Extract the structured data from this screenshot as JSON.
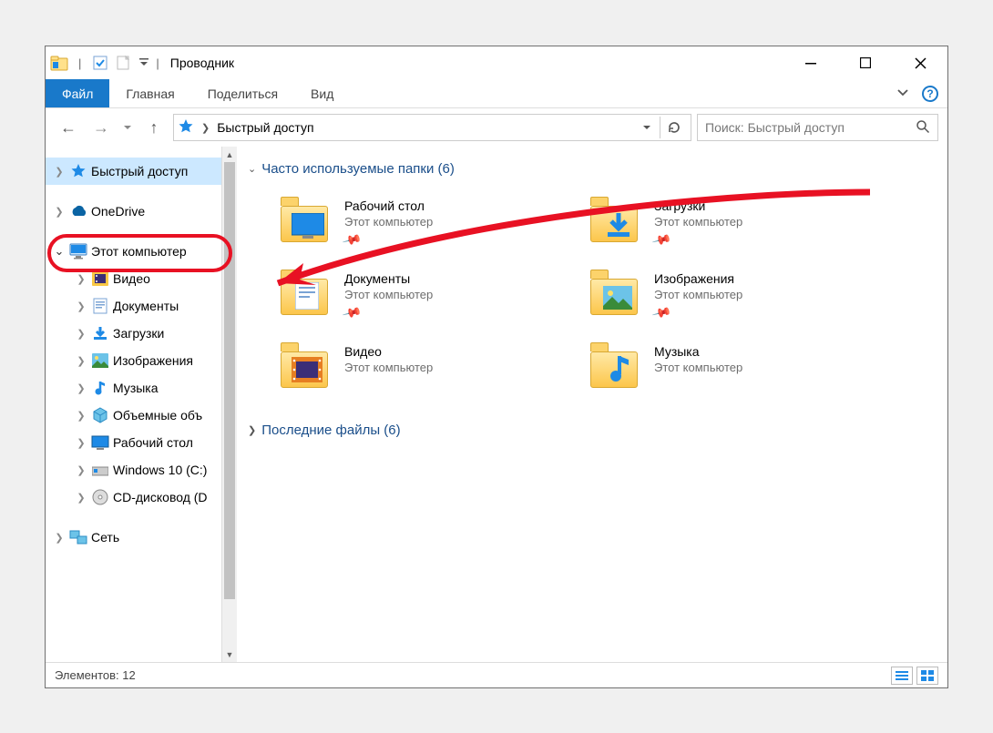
{
  "window": {
    "title": "Проводник"
  },
  "ribbon": {
    "file": "Файл",
    "tabs": [
      "Главная",
      "Поделиться",
      "Вид"
    ]
  },
  "address": {
    "crumb": "Быстрый доступ"
  },
  "search": {
    "placeholder": "Поиск: Быстрый доступ"
  },
  "sidebar": {
    "quick_access": "Быстрый доступ",
    "onedrive": "OneDrive",
    "this_pc": "Этот компьютер",
    "children": [
      "Видео",
      "Документы",
      "Загрузки",
      "Изображения",
      "Музыка",
      "Объемные объ",
      "Рабочий стол",
      "Windows 10 (C:)",
      "CD-дисковод (D"
    ],
    "network": "Сеть"
  },
  "content": {
    "frequent_header": "Часто используемые папки (6)",
    "recent_header": "Последние файлы (6)",
    "sub_location": "Этот компьютер",
    "folders": [
      {
        "name": "Рабочий стол"
      },
      {
        "name": "Загрузки"
      },
      {
        "name": "Документы"
      },
      {
        "name": "Изображения"
      },
      {
        "name": "Видео"
      },
      {
        "name": "Музыка"
      }
    ]
  },
  "status": {
    "text": "Элементов: 12"
  }
}
